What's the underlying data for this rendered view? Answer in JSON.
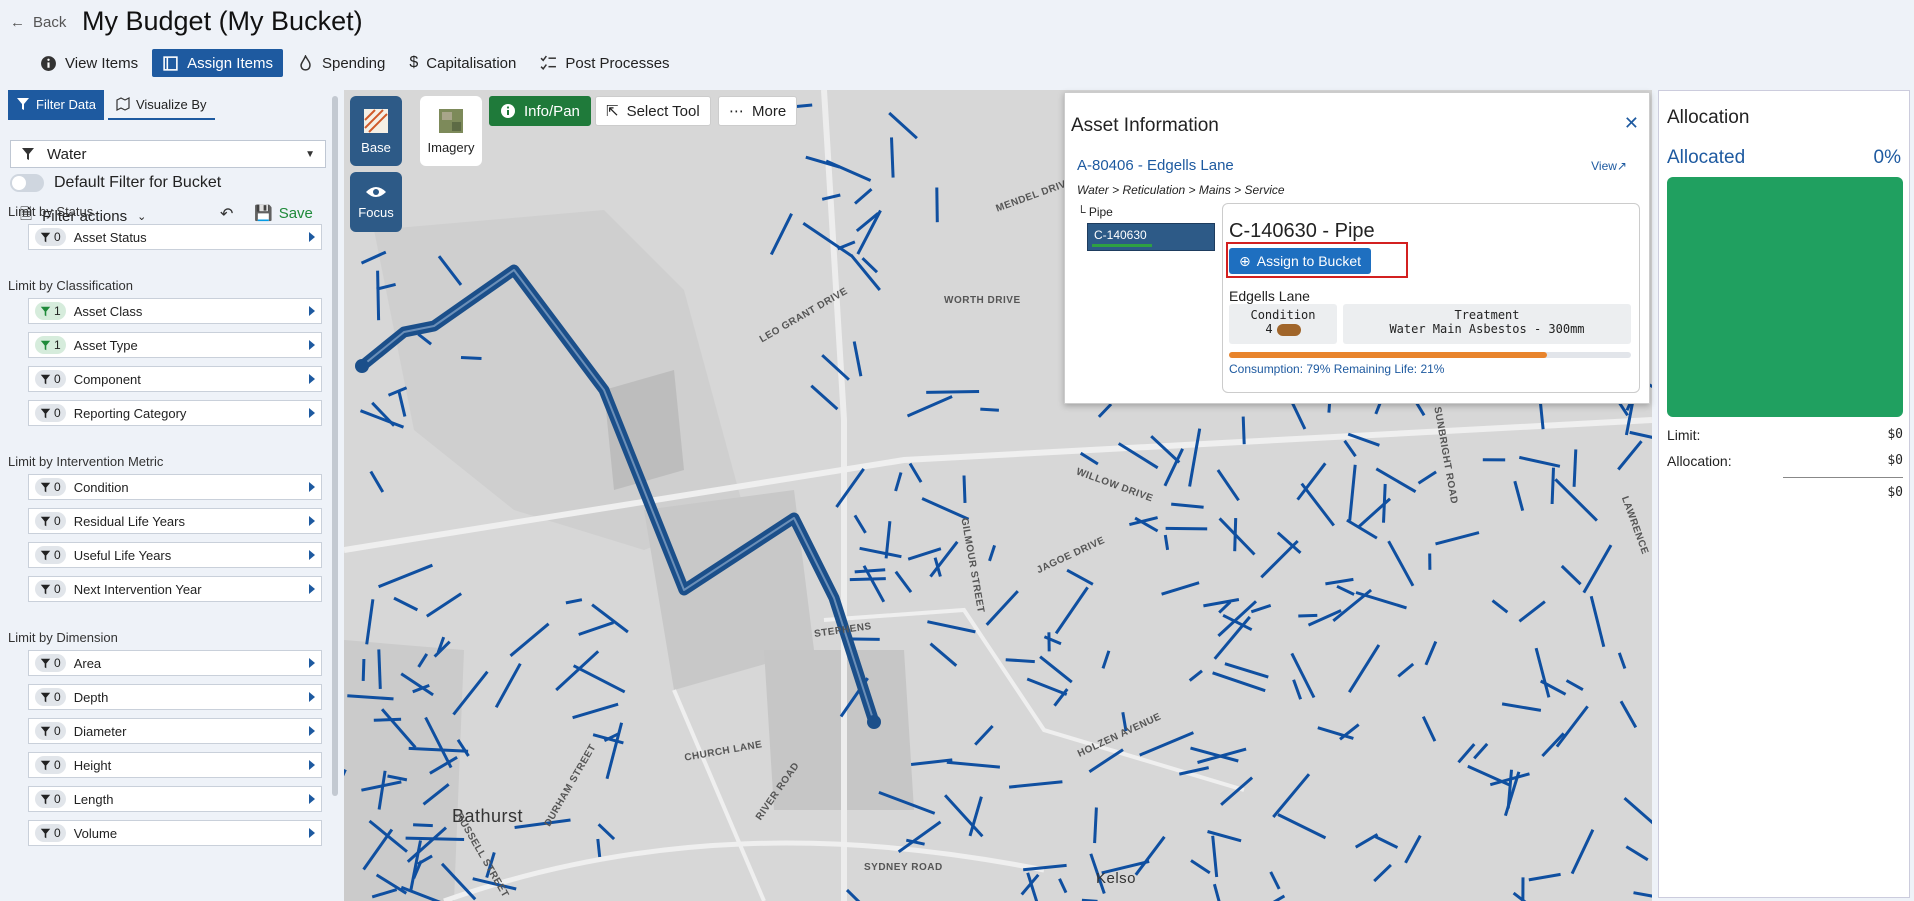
{
  "header": {
    "back_label": "Back",
    "title": "My Budget (My Bucket)",
    "tabs": [
      {
        "label": "View Items",
        "icon": "info-icon"
      },
      {
        "label": "Assign Items",
        "icon": "book-icon",
        "active": true
      },
      {
        "label": "Spending",
        "icon": "flame-icon"
      },
      {
        "label": "Capitalisation",
        "icon": "dollar-icon"
      },
      {
        "label": "Post Processes",
        "icon": "list-check-icon"
      }
    ]
  },
  "left": {
    "tabs": [
      {
        "label": "Filter Data",
        "active": true
      },
      {
        "label": "Visualize By"
      }
    ],
    "filter_select": "Water",
    "default_filter_label": "Default Filter for Bucket",
    "filter_actions": "Filter actions",
    "save_label": "Save",
    "sections": [
      {
        "title": "Limit by Status",
        "rows": [
          {
            "label": "Asset Status",
            "count": "0"
          }
        ]
      },
      {
        "title": "Limit by Classification",
        "rows": [
          {
            "label": "Asset Class",
            "count": "1",
            "on": true
          },
          {
            "label": "Asset Type",
            "count": "1",
            "on": true
          },
          {
            "label": "Component",
            "count": "0"
          },
          {
            "label": "Reporting Category",
            "count": "0"
          }
        ]
      },
      {
        "title": "Limit by Intervention Metric",
        "rows": [
          {
            "label": "Condition",
            "count": "0"
          },
          {
            "label": "Residual Life Years",
            "count": "0"
          },
          {
            "label": "Useful Life Years",
            "count": "0"
          },
          {
            "label": "Next Intervention Year",
            "count": "0"
          }
        ]
      },
      {
        "title": "Limit by Dimension",
        "rows": [
          {
            "label": "Area",
            "count": "0"
          },
          {
            "label": "Depth",
            "count": "0"
          },
          {
            "label": "Diameter",
            "count": "0"
          },
          {
            "label": "Height",
            "count": "0"
          },
          {
            "label": "Length",
            "count": "0"
          },
          {
            "label": "Volume",
            "count": "0"
          }
        ]
      }
    ]
  },
  "map": {
    "base_label": "Base",
    "imagery_label": "Imagery",
    "focus_label": "Focus",
    "info_pan_label": "Info/Pan",
    "select_tool_label": "Select Tool",
    "more_label": "More",
    "labels": [
      "MENDEL DRIVE",
      "WORTH DRIVE",
      "LEO GRANT DRIVE",
      "WILLOW DRIVE",
      "JAGOE DRIVE",
      "STEPHENS",
      "CHURCH LANE",
      "RIVER ROAD",
      "SYDNEY ROAD",
      "Bathurst",
      "Kelso",
      "HOLZEN AVENUE",
      "SUNBRIGHT ROAD",
      "LAWRENCE",
      "GILMOUR STREET",
      "DURHAM STREET",
      "RUSSELL STREET"
    ],
    "route_color": "#1b4f8a",
    "pipe_color": "#0f4fa0"
  },
  "asset": {
    "heading": "Asset Information",
    "link": "A-80406 - Edgells Lane",
    "view_label": "View↗",
    "crumb": "Water > Reticulation > Mains > Service",
    "pipe_label": "└ Pipe",
    "chip": "C-140630",
    "card_title": "C-140630 - Pipe",
    "assign_label": "Assign to Bucket",
    "street": "Edgells Lane",
    "condition_label": "Condition",
    "condition_value": "4",
    "treatment_label": "Treatment",
    "treatment_value": "Water Main Asbestos - 300mm",
    "consumption_pct": 79,
    "consumption_text": "Consumption: 79%  Remaining Life: 21%"
  },
  "allocation": {
    "heading": "Allocation",
    "allocated_label": "Allocated",
    "allocated_pct": "0%",
    "limit_label": "Limit:",
    "limit_value": "$0",
    "allocation_label": "Allocation:",
    "allocation_value": "$0",
    "total_value": "$0"
  }
}
